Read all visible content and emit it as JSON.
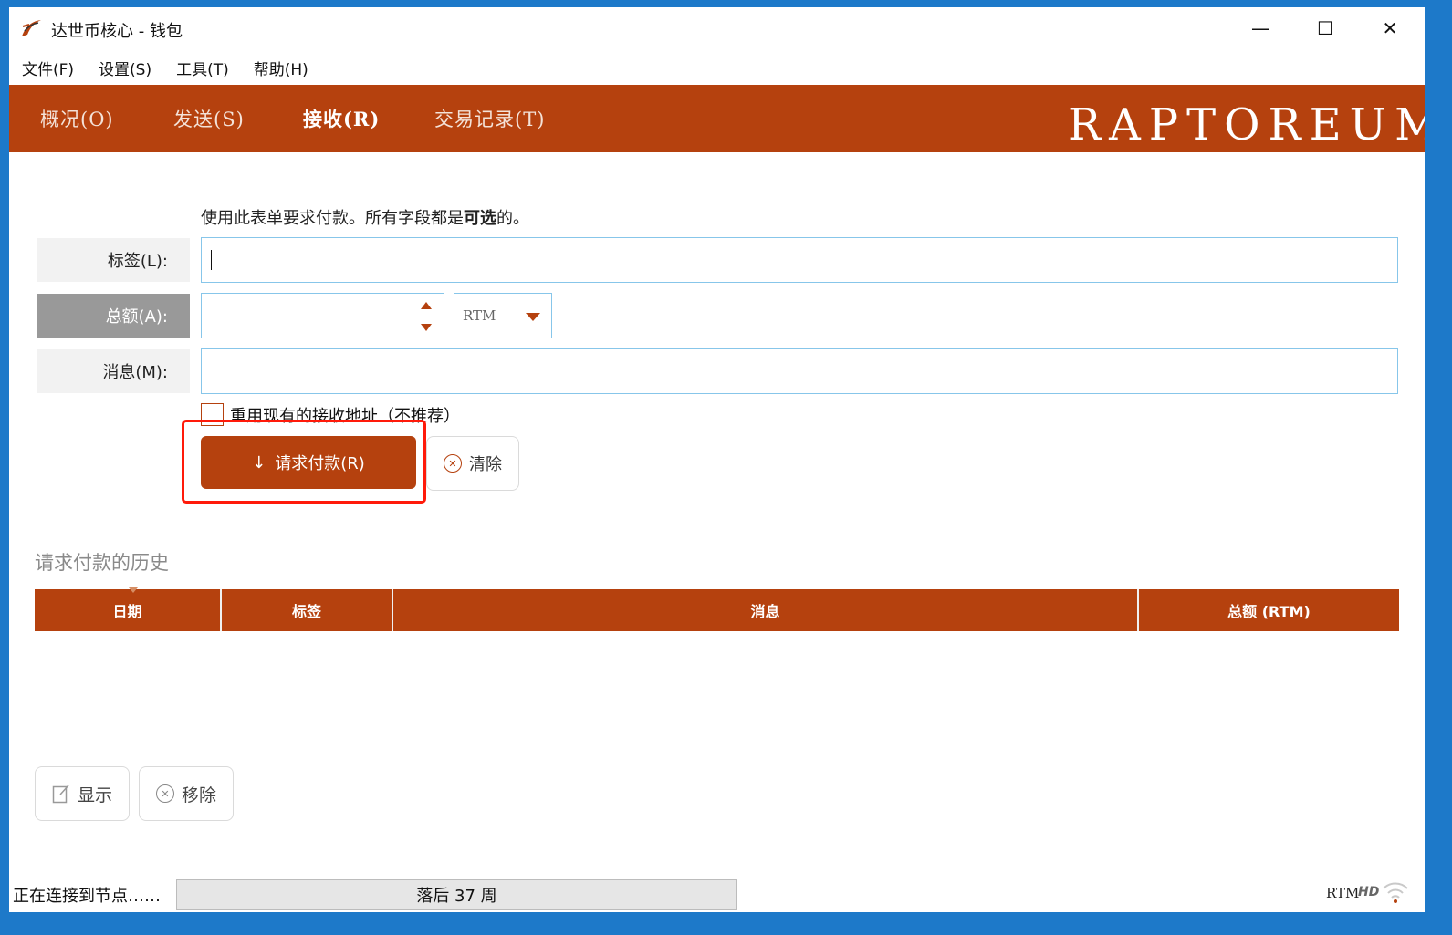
{
  "window": {
    "title": "达世币核心 - 钱包",
    "controls": {
      "minimize": "—",
      "maximize": "☐",
      "close": "✕"
    }
  },
  "menu": {
    "items": [
      {
        "label": "文件(F)"
      },
      {
        "label": "设置(S)"
      },
      {
        "label": "工具(T)"
      },
      {
        "label": "帮助(H)"
      }
    ]
  },
  "tabs": {
    "overview": "概况(O)",
    "send": "发送(S)",
    "receive": "接收(R)",
    "history": "交易记录(T)",
    "active": "receive",
    "brand": "RAPTOREUM"
  },
  "form": {
    "intro_prefix": "使用此表单要求付款。所有字段都是",
    "intro_bold": "可选",
    "intro_suffix": "的。",
    "label_label": "标签(L):",
    "label_value": "",
    "amount_label": "总额(A):",
    "amount_value": "",
    "unit": "RTM",
    "message_label": "消息(M):",
    "message_value": "",
    "reuse_label": "重用现有的接收地址（不推荐）",
    "reuse_checked": false,
    "request_button": "请求付款(R)",
    "clear_button": "清除"
  },
  "history": {
    "title": "请求付款的历史",
    "columns": [
      "日期",
      "标签",
      "消息",
      "总额 (RTM)"
    ],
    "rows": [],
    "show_button": "显示",
    "remove_button": "移除"
  },
  "statusbar": {
    "status": "正在连接到节点……",
    "sync": "落后 37 周",
    "unit": "RTM",
    "hd": "HD"
  },
  "colors": {
    "accent": "#b5410e",
    "highlight": "#ff1a0a",
    "input_border": "#87c6ea"
  },
  "icons": {
    "app": "raptoreum-logo-icon",
    "request": "arrow-down-icon",
    "clear": "circle-x-icon",
    "show": "edit-document-icon",
    "remove": "circle-x-icon",
    "network": "wifi-signal-icon"
  }
}
